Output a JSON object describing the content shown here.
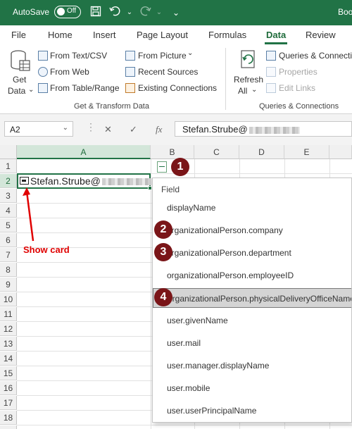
{
  "titlebar": {
    "autosave_label": "AutoSave",
    "toggle_state": "Off",
    "book_title": "Boo"
  },
  "tabs": [
    {
      "label": "File",
      "active": false
    },
    {
      "label": "Home",
      "active": false
    },
    {
      "label": "Insert",
      "active": false
    },
    {
      "label": "Page Layout",
      "active": false
    },
    {
      "label": "Formulas",
      "active": false
    },
    {
      "label": "Data",
      "active": true
    },
    {
      "label": "Review",
      "active": false
    }
  ],
  "ribbon": {
    "get_data": {
      "line1": "Get",
      "line2": "Data"
    },
    "from_text_csv": "From Text/CSV",
    "from_web": "From Web",
    "from_table_range": "From Table/Range",
    "from_picture": "From Picture",
    "recent_sources": "Recent Sources",
    "existing_connections": "Existing Connections",
    "get_transform_group": "Get & Transform Data",
    "refresh_all": {
      "line1": "Refresh",
      "line2": "All"
    },
    "queries_connections": "Queries & Connectio",
    "properties": "Properties",
    "edit_links": "Edit Links",
    "queries_group": "Queries & Connections"
  },
  "formula_bar": {
    "name_box": "A2",
    "fx_label": "fx",
    "content": "Stefan.Strube@"
  },
  "columns": [
    "A",
    "B",
    "C",
    "D",
    "E"
  ],
  "rows": [
    "1",
    "2",
    "3",
    "4",
    "5",
    "6",
    "7",
    "8",
    "9",
    "10",
    "11",
    "12",
    "13",
    "14",
    "15",
    "16",
    "17",
    "18",
    "19"
  ],
  "cell_a2": "Stefan.Strube@",
  "annotation": {
    "show_card": "Show card"
  },
  "badges": [
    "1",
    "2",
    "3",
    "4"
  ],
  "dropdown": {
    "header": "Field",
    "items": [
      "displayName",
      "organizationalPerson.company",
      "organizationalPerson.department",
      "organizationalPerson.employeeID",
      "organizationalPerson.physicalDeliveryOfficeName",
      "user.givenName",
      "user.mail",
      "user.manager.displayName",
      "user.mobile",
      "user.userPrincipalName"
    ],
    "highlighted": "organizationalPerson.physicalDeliveryOfficeName"
  }
}
